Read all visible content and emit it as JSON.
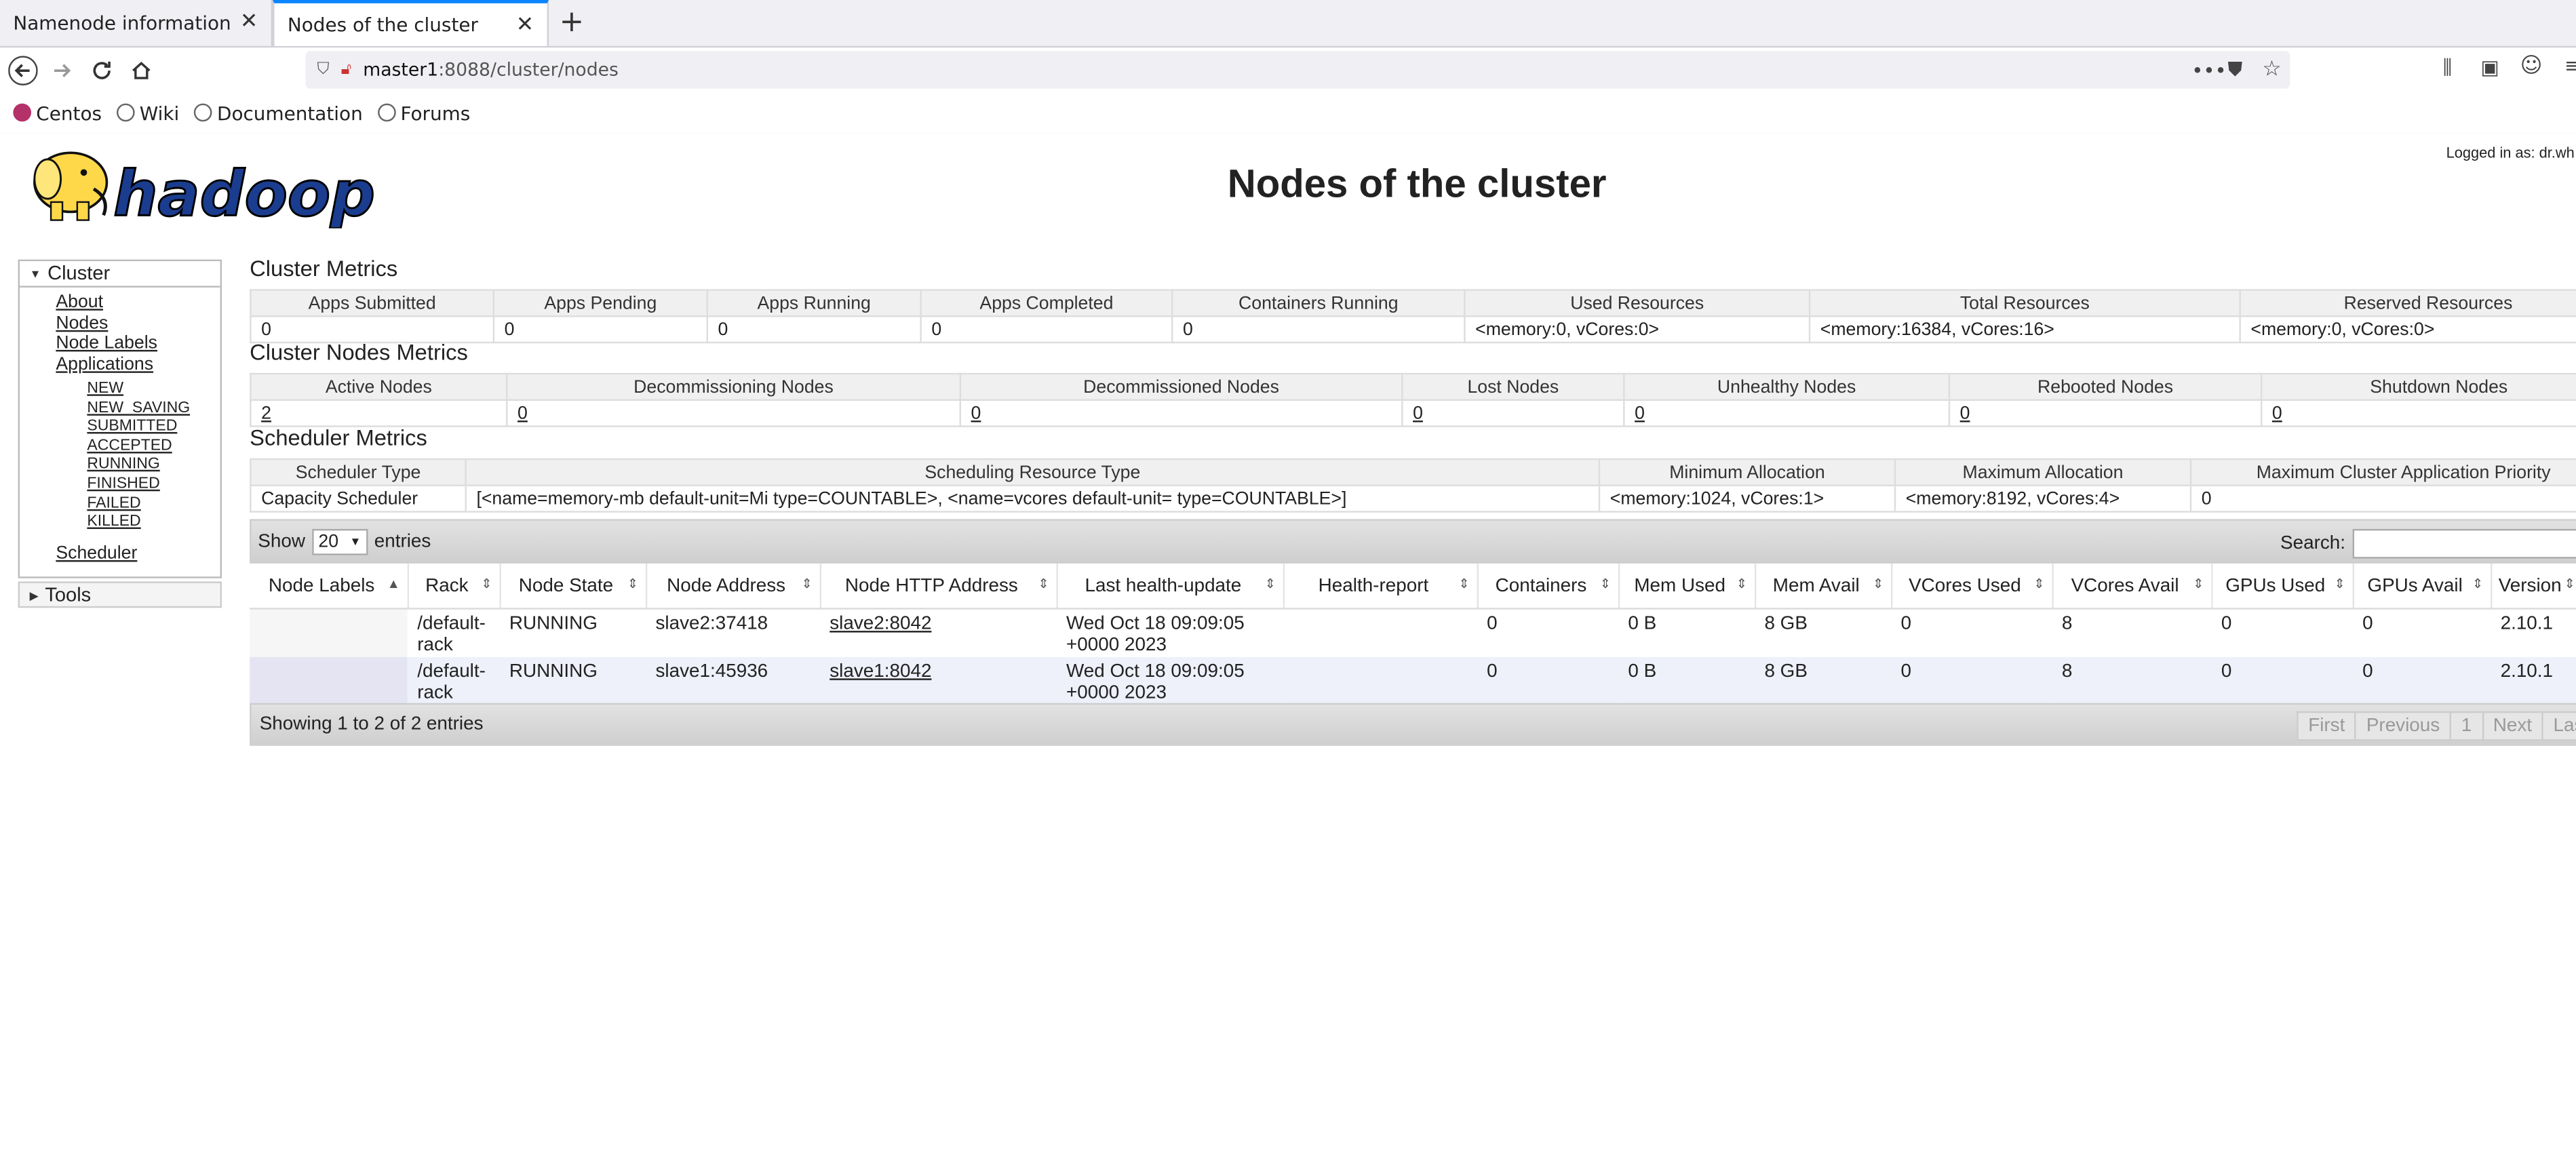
{
  "browser": {
    "tabs": [
      {
        "label": "Namenode information",
        "active": false
      },
      {
        "label": "Nodes of the cluster",
        "active": true
      }
    ],
    "url_host": "master1",
    "url_path": ":8088/cluster/nodes",
    "bookmarks": [
      "Centos",
      "Wiki",
      "Documentation",
      "Forums"
    ]
  },
  "header": {
    "logo_text": "hadoop",
    "title": "Nodes of the cluster",
    "logged_in": "Logged in as: dr.wh"
  },
  "nav": {
    "cluster_label": "Cluster",
    "cluster_items": [
      "About",
      "Nodes",
      "Node Labels",
      "Applications"
    ],
    "app_states": [
      "NEW",
      "NEW_SAVING",
      "SUBMITTED",
      "ACCEPTED",
      "RUNNING",
      "FINISHED",
      "FAILED",
      "KILLED"
    ],
    "scheduler": "Scheduler",
    "tools": "Tools"
  },
  "cluster_metrics": {
    "title": "Cluster Metrics",
    "headers": [
      "Apps Submitted",
      "Apps Pending",
      "Apps Running",
      "Apps Completed",
      "Containers Running",
      "Used Resources",
      "Total Resources",
      "Reserved Resources"
    ],
    "values": [
      "0",
      "0",
      "0",
      "0",
      "0",
      "<memory:0, vCores:0>",
      "<memory:16384, vCores:16>",
      "<memory:0, vCores:0>"
    ]
  },
  "nodes_metrics": {
    "title": "Cluster Nodes Metrics",
    "headers": [
      "Active Nodes",
      "Decommissioning Nodes",
      "Decommissioned Nodes",
      "Lost Nodes",
      "Unhealthy Nodes",
      "Rebooted Nodes",
      "Shutdown Nodes"
    ],
    "values": [
      "2",
      "0",
      "0",
      "0",
      "0",
      "0",
      "0"
    ]
  },
  "scheduler_metrics": {
    "title": "Scheduler Metrics",
    "headers": [
      "Scheduler Type",
      "Scheduling Resource Type",
      "Minimum Allocation",
      "Maximum Allocation",
      "Maximum Cluster Application Priority"
    ],
    "values": [
      "Capacity Scheduler",
      "[<name=memory-mb default-unit=Mi type=COUNTABLE>, <name=vcores default-unit= type=COUNTABLE>]",
      "<memory:1024, vCores:1>",
      "<memory:8192, vCores:4>",
      "0"
    ]
  },
  "table_controls": {
    "show": "Show",
    "page_size": "20",
    "entries": "entries",
    "search": "Search:"
  },
  "nodes_table": {
    "headers": [
      "Node Labels",
      "Rack",
      "Node State",
      "Node Address",
      "Node HTTP Address",
      "Last health-update",
      "Health-report",
      "Containers",
      "Mem Used",
      "Mem Avail",
      "VCores Used",
      "VCores Avail",
      "GPUs Used",
      "GPUs Avail",
      "Version"
    ],
    "rows": [
      [
        "",
        "/default-rack",
        "RUNNING",
        "slave2:37418",
        "slave2:8042",
        "Wed Oct 18 09:09:05 +0000 2023",
        "",
        "0",
        "0 B",
        "8 GB",
        "0",
        "8",
        "0",
        "0",
        "2.10.1"
      ],
      [
        "",
        "/default-rack",
        "RUNNING",
        "slave1:45936",
        "slave1:8042",
        "Wed Oct 18 09:09:05 +0000 2023",
        "",
        "0",
        "0 B",
        "8 GB",
        "0",
        "8",
        "0",
        "0",
        "2.10.1"
      ]
    ]
  },
  "footer": {
    "info": "Showing 1 to 2 of 2 entries",
    "pager": [
      "First",
      "Previous",
      "1",
      "Next",
      "Last"
    ]
  }
}
